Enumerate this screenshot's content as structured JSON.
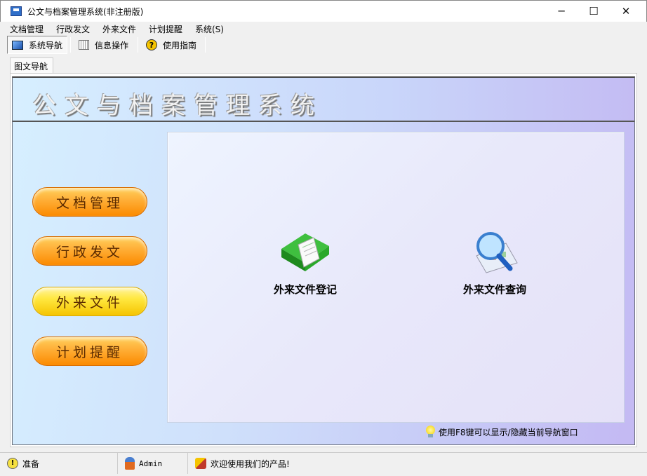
{
  "window": {
    "title": "公文与档案管理系统(非注册版)",
    "minimize": "─",
    "maximize": "☐",
    "close": "✕"
  },
  "menu": [
    "文档管理",
    "行政发文",
    "外来文件",
    "计划提醒",
    "系统(S)"
  ],
  "toolbar": [
    {
      "label": "系统导航",
      "icon": "monitor-icon"
    },
    {
      "label": "信息操作",
      "icon": "grid-icon"
    },
    {
      "label": "使用指南",
      "icon": "help-icon"
    }
  ],
  "tab": "图文导航",
  "banner": "公文与档案管理系统",
  "nav_buttons": [
    "文档管理",
    "行政发文",
    "外来文件",
    "计划提醒"
  ],
  "selected_nav": "外来文件",
  "features": [
    {
      "label": "外来文件登记",
      "icon": "green-book-icon"
    },
    {
      "label": "外来文件查询",
      "icon": "magnifier-icon"
    }
  ],
  "hint": "使用F8键可以显示/隐藏当前导航窗口",
  "status": {
    "state": "准备",
    "user": "Admin",
    "welcome": "欢迎使用我们的产品!"
  }
}
